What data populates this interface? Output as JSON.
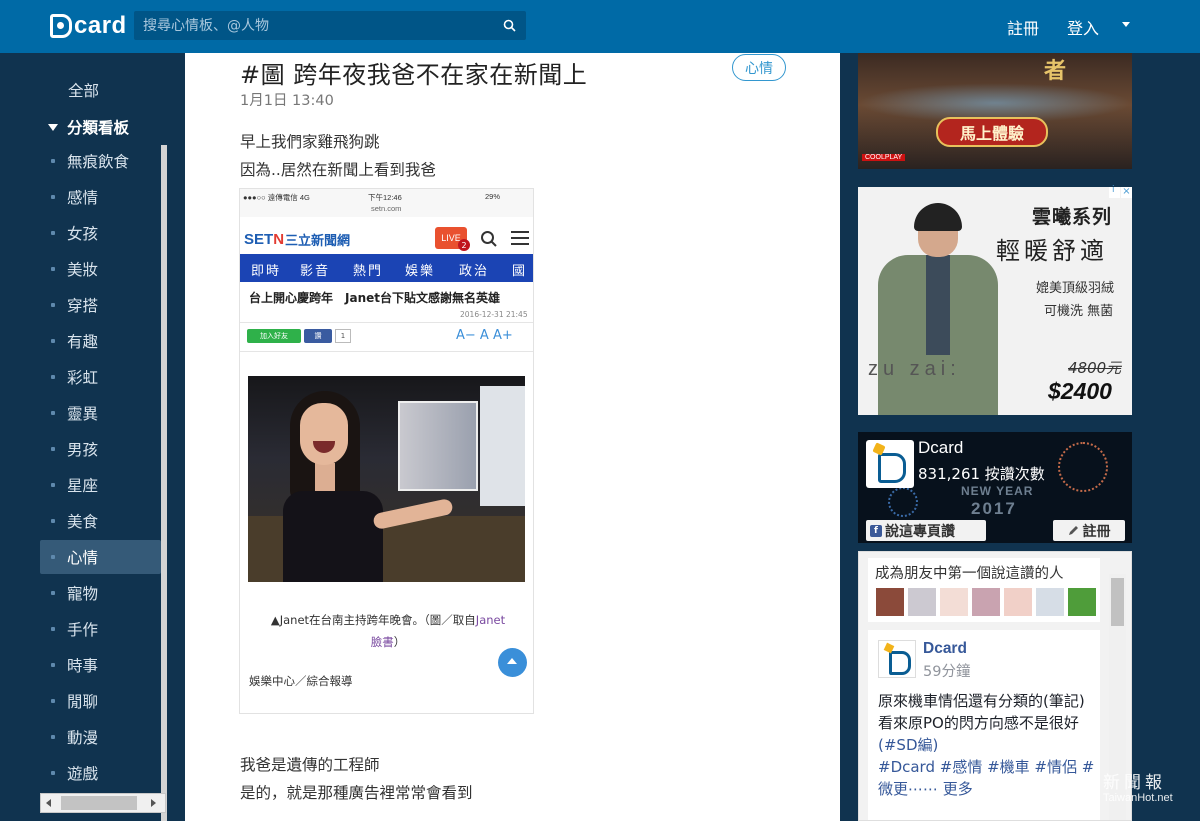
{
  "brand": {
    "logo_text": "card"
  },
  "search": {
    "placeholder": "搜尋心情板、@人物"
  },
  "nav": {
    "register": "註冊",
    "login": "登入"
  },
  "sidebar": {
    "all": "全部",
    "category_header": "分類看板",
    "items": [
      {
        "label": "無痕飲食"
      },
      {
        "label": "感情"
      },
      {
        "label": "女孩"
      },
      {
        "label": "美妝"
      },
      {
        "label": "穿搭"
      },
      {
        "label": "有趣"
      },
      {
        "label": "彩虹"
      },
      {
        "label": "靈異"
      },
      {
        "label": "男孩"
      },
      {
        "label": "星座"
      },
      {
        "label": "美食"
      },
      {
        "label": "心情",
        "active": true
      },
      {
        "label": "寵物"
      },
      {
        "label": "手作"
      },
      {
        "label": "時事"
      },
      {
        "label": "閒聊"
      },
      {
        "label": "動漫"
      },
      {
        "label": "遊戲"
      }
    ]
  },
  "post": {
    "title": "#圖 跨年夜我爸不在家在新聞上",
    "time": "1月1日 13:40",
    "board": "心情",
    "intro": [
      "早上我們家雞飛狗跳",
      "因為..居然在新聞上看到我爸"
    ],
    "body": [
      "我爸是遺傳的工程師",
      "是的，就是那種廣告裡常常會看到"
    ]
  },
  "embedded": {
    "status_carrier": "●●●○○ 遠傳電信  4G",
    "status_time": "下午12:46",
    "status_url": "setn.com",
    "status_battery": "29%",
    "site_name": "三立新聞網",
    "live_label": "LIVE",
    "live_count": "2",
    "nav_tabs": [
      "即時",
      "影音",
      "熱門",
      "娛樂",
      "政治",
      "國"
    ],
    "headline": "台上開心慶跨年　Janet台下貼文感謝無名英雄",
    "date": "2016-12-31 21:45",
    "share_line": "加入好友",
    "share_fb": "讚",
    "share_count": "1",
    "font_controls": "A−  A  A+",
    "caption_prefix": "▲Janet在台南主持跨年晚會。（圖／取自",
    "caption_link": "Janet",
    "caption_link2": "臉書",
    "caption_suffix": "）",
    "source": "娛樂中心／綜合報導"
  },
  "ads": {
    "game_title": "者",
    "game_button": "馬上體驗",
    "game_brand": "COOLPLAY",
    "coat_line1": "雲曦系列",
    "coat_line2": "輕暖舒適",
    "coat_line3": "媲美頂級羽絨",
    "coat_line4": "可機洗 無菌",
    "coat_old_price": "4800元",
    "coat_new_price": "$2400",
    "coat_brand": "zu zai:"
  },
  "fb_page": {
    "name": "Dcard",
    "likes": "831,261 按讚次數",
    "new_year": "NEW YEAR",
    "year": "2017",
    "like_button": "說這專頁讚",
    "share_button": "註冊"
  },
  "fb_feed": {
    "friends_title": "成為朋友中第一個說這讚的人",
    "post_name": "Dcard",
    "post_time": "59分鐘",
    "post_text_1": "原來機車情侶還有分類的(筆記)",
    "post_text_2": "看來原PO的閃方向感不是很好",
    "post_tag_1": "(#SD編)",
    "post_tags_2": "#Dcard #感情 #機車 #情侶 #",
    "post_more": "微更⋯⋯ 更多"
  },
  "watermark": {
    "title": "新聞報",
    "sub": "TaiwanHot.net"
  }
}
